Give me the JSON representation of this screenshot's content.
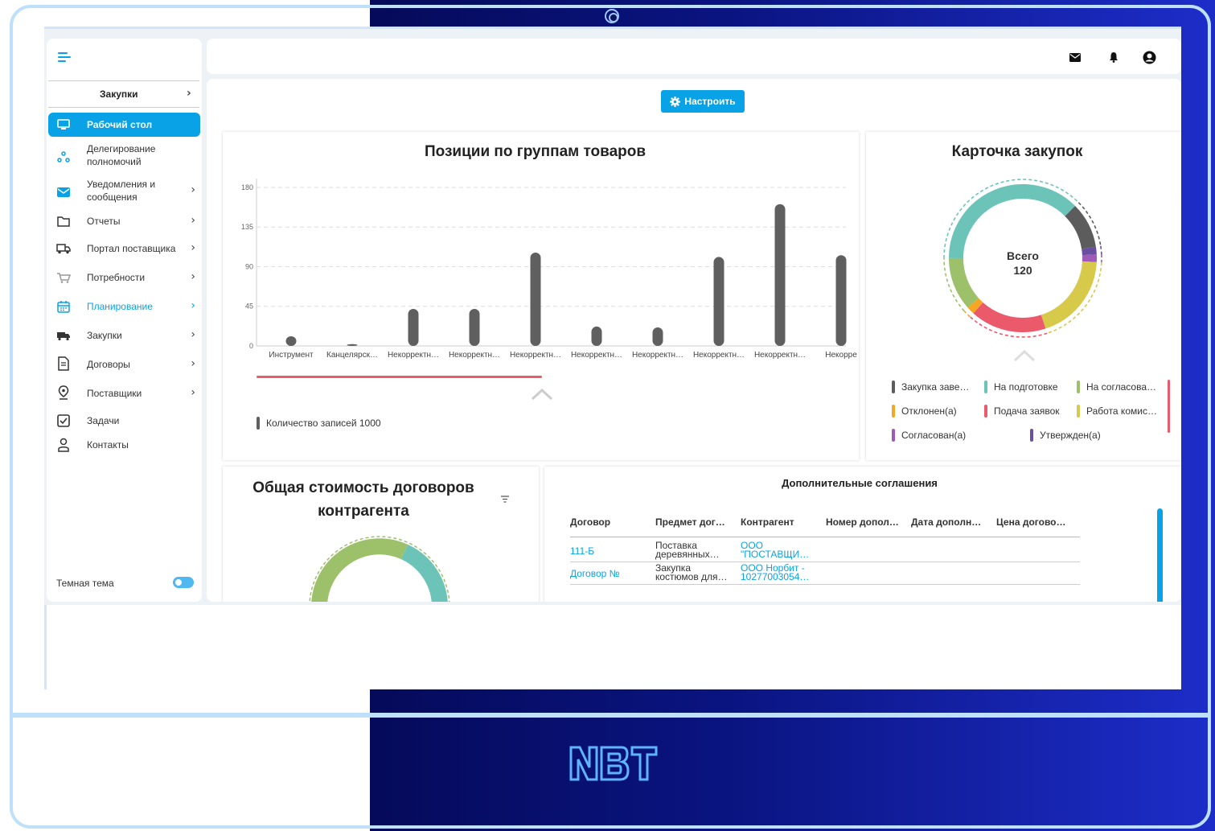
{
  "device": {
    "brand_logo": "NBT"
  },
  "sidebar": {
    "section": "Закупки",
    "items": [
      {
        "label": "Рабочий стол",
        "icon": "monitor-icon"
      },
      {
        "label": "Делегирование полномочий",
        "icon": "share-icon"
      },
      {
        "label": "Уведомления и сообщения",
        "icon": "mail-icon"
      },
      {
        "label": "Отчеты",
        "icon": "folder-icon"
      },
      {
        "label": "Портал поставщика",
        "icon": "truck-icon"
      },
      {
        "label": "Потребности",
        "icon": "cart-icon"
      },
      {
        "label": "Планирование",
        "icon": "calendar-icon"
      },
      {
        "label": "Закупки",
        "icon": "delivery-icon"
      },
      {
        "label": "Договоры",
        "icon": "document-icon"
      },
      {
        "label": "Поставщики",
        "icon": "location-pin-icon"
      },
      {
        "label": "Задачи",
        "icon": "checkbox-icon"
      },
      {
        "label": "Контакты",
        "icon": "person-icon"
      }
    ],
    "dark_theme_label": "Темная тема",
    "dark_theme_on": true
  },
  "main": {
    "config_button": "Настроить"
  },
  "bar_card": {
    "title": "Позиции по группам товаров",
    "legend": "Количество записей 1000",
    "color": "#5f5f5f"
  },
  "chart_data": [
    {
      "type": "bar",
      "title": "Позиции по группам товаров",
      "categories": [
        "Инструмент",
        "Канцелярск…",
        "Некорректн…",
        "Некорректн…",
        "Некорректн…",
        "Некорректн…",
        "Некорректн…",
        "Некорректн…",
        "Некорректн…",
        "Некорре"
      ],
      "series": [
        {
          "name": "Количество записей 1000",
          "values": [
            11,
            2,
            42,
            42,
            106,
            22,
            21,
            101,
            161,
            103
          ]
        }
      ],
      "yticks": [
        0,
        45,
        90,
        135,
        180
      ],
      "ylim": [
        0,
        190
      ],
      "grid": true,
      "legend_position": "bottom-left"
    },
    {
      "type": "pie",
      "title": "Карточка закупок",
      "center_label": "Всего",
      "center_value": "120",
      "slices": [
        {
          "name": "Закупка заве…",
          "value": 12,
          "color": "#5c5c5c"
        },
        {
          "name": "На подготовке",
          "value": 45,
          "color": "#6cc4b9"
        },
        {
          "name": "На согласова…",
          "value": 14,
          "color": "#9cc16a"
        },
        {
          "name": "Отклонен(а)",
          "value": 2,
          "color": "#f5a623"
        },
        {
          "name": "Подача заявок",
          "value": 20,
          "color": "#ea5a6b"
        },
        {
          "name": "Работа комис…",
          "value": 23,
          "color": "#d7c94a"
        },
        {
          "name": "Согласован(а)",
          "value": 2,
          "color": "#a05ab8"
        },
        {
          "name": "Утвержден(а)",
          "value": 2,
          "color": "#6a4fa0"
        }
      ]
    }
  ],
  "contract_card": {
    "title": "Общая стоимость договоров контрагента",
    "menu_icon": "filter-lines-icon"
  },
  "agreements": {
    "title": "Дополнительные соглашения",
    "columns": [
      "Договор",
      "Предмет дог…",
      "Контрагент",
      "Номер допол…",
      "Дата дополн…",
      "Цена догово…"
    ],
    "rows": [
      {
        "contract": "111-Б",
        "subject_1": "Поставка",
        "subject_2": "деревянных…",
        "party_1": "ООО",
        "party_2": "\"ПОСТАВЩИ…"
      },
      {
        "contract": "Договор №",
        "subject_1": "Закупка",
        "subject_2": "костюмов для…",
        "party_1": "ООО Норбит -",
        "party_2": "10277003054…"
      }
    ]
  }
}
